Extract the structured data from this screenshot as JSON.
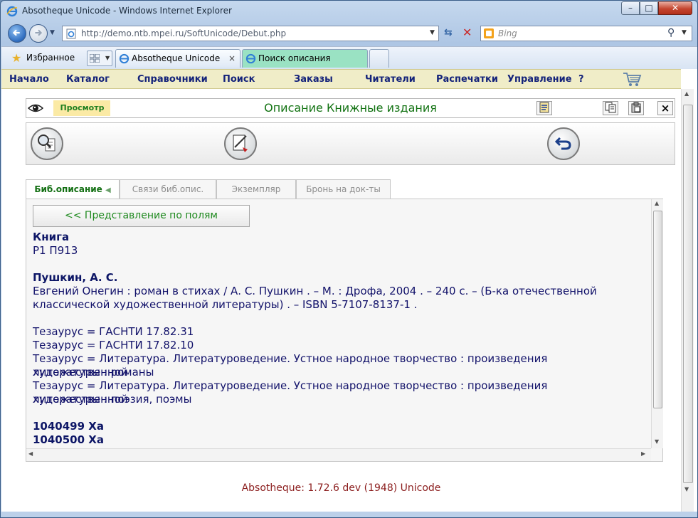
{
  "window": {
    "title": "Absotheque Unicode - Windows Internet Explorer",
    "address": "http://demo.ntb.mpei.ru/SoftUnicode/Debut.php",
    "search_placeholder": "Bing",
    "favorites_label": "Избранное",
    "tabs": [
      {
        "label": "Absotheque Unicode",
        "active": true
      },
      {
        "label": "Поиск описания",
        "active": false
      }
    ]
  },
  "menu": {
    "items": [
      "Начало",
      "Каталог",
      "Справочники",
      "Поиск",
      "Заказы",
      "Читатели",
      "Распечатки",
      "Управление",
      "?"
    ]
  },
  "panel": {
    "view_label": "Просмотр",
    "title": "Описание Книжные издания",
    "close_glyph": "×"
  },
  "record_tabs": [
    "Биб.описание",
    "Связи биб.опис.",
    "Экземпляр",
    "Бронь на док-ты"
  ],
  "record": {
    "fields_button": "<< Представление по полям",
    "type": "Книга",
    "code": "Р1 П913",
    "author": "Пушкин, А. С.",
    "description_1": "Евгений Онегин : роман в стихах / А. С. Пушкин . – М. : Дрофа, 2004 . – 240 с. – (Б-ка отечественной",
    "description_2": "классической художественной литературы) . – ISBN 5-7107-8137-1 .",
    "thesaurus": [
      "Тезаурус = ГАСНТИ 17.82.31",
      "Тезаурус = ГАСНТИ 17.82.10",
      "Тезаурус = Литература. Литературоведение. Устное народное творчество : произведения художественной",
      "литературы : романы",
      "Тезаурус = Литература. Литературоведение. Устное народное творчество : произведения художественной",
      "литературы : поэзия, поэмы"
    ],
    "copies": [
      "1040499 Ха",
      "1040500 Ха"
    ]
  },
  "footer": {
    "version": "Absotheque: 1.72.6 dev (1948) Unicode"
  },
  "colors": {
    "menu_bg": "#f0edc8",
    "menu_text": "#14237a",
    "title_green": "#137313",
    "record_text": "#12126a",
    "version_text": "#8b1d1d"
  }
}
